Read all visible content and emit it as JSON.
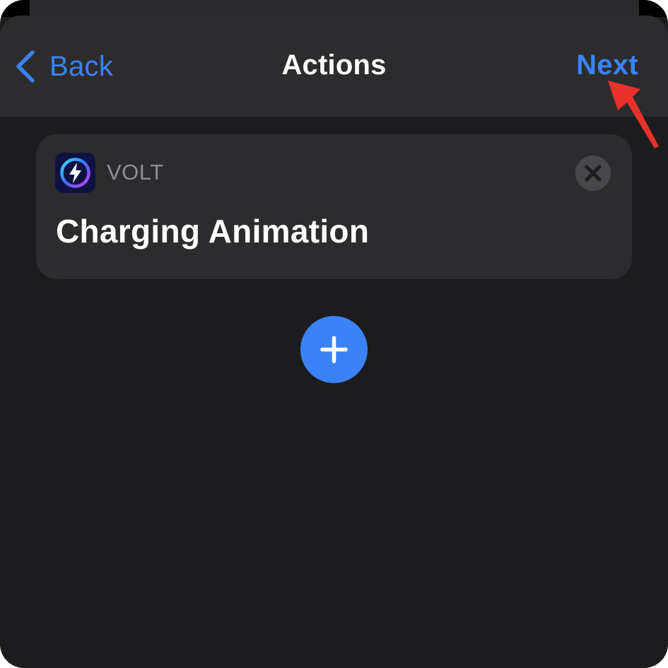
{
  "navbar": {
    "back_label": "Back",
    "title": "Actions",
    "next_label": "Next"
  },
  "action": {
    "app_name": "VOLT",
    "title": "Charging Animation",
    "app_icon": "lightning-bolt-icon"
  },
  "icons": {
    "back": "chevron-left-icon",
    "remove": "close-icon",
    "add": "plus-icon",
    "annotation": "red-arrow-icon"
  },
  "colors": {
    "accent": "#3b82f6",
    "background": "#1c1c1e",
    "surface": "#2c2c2e",
    "secondary_text": "#8e8e93",
    "annotation": "#e8312a"
  }
}
